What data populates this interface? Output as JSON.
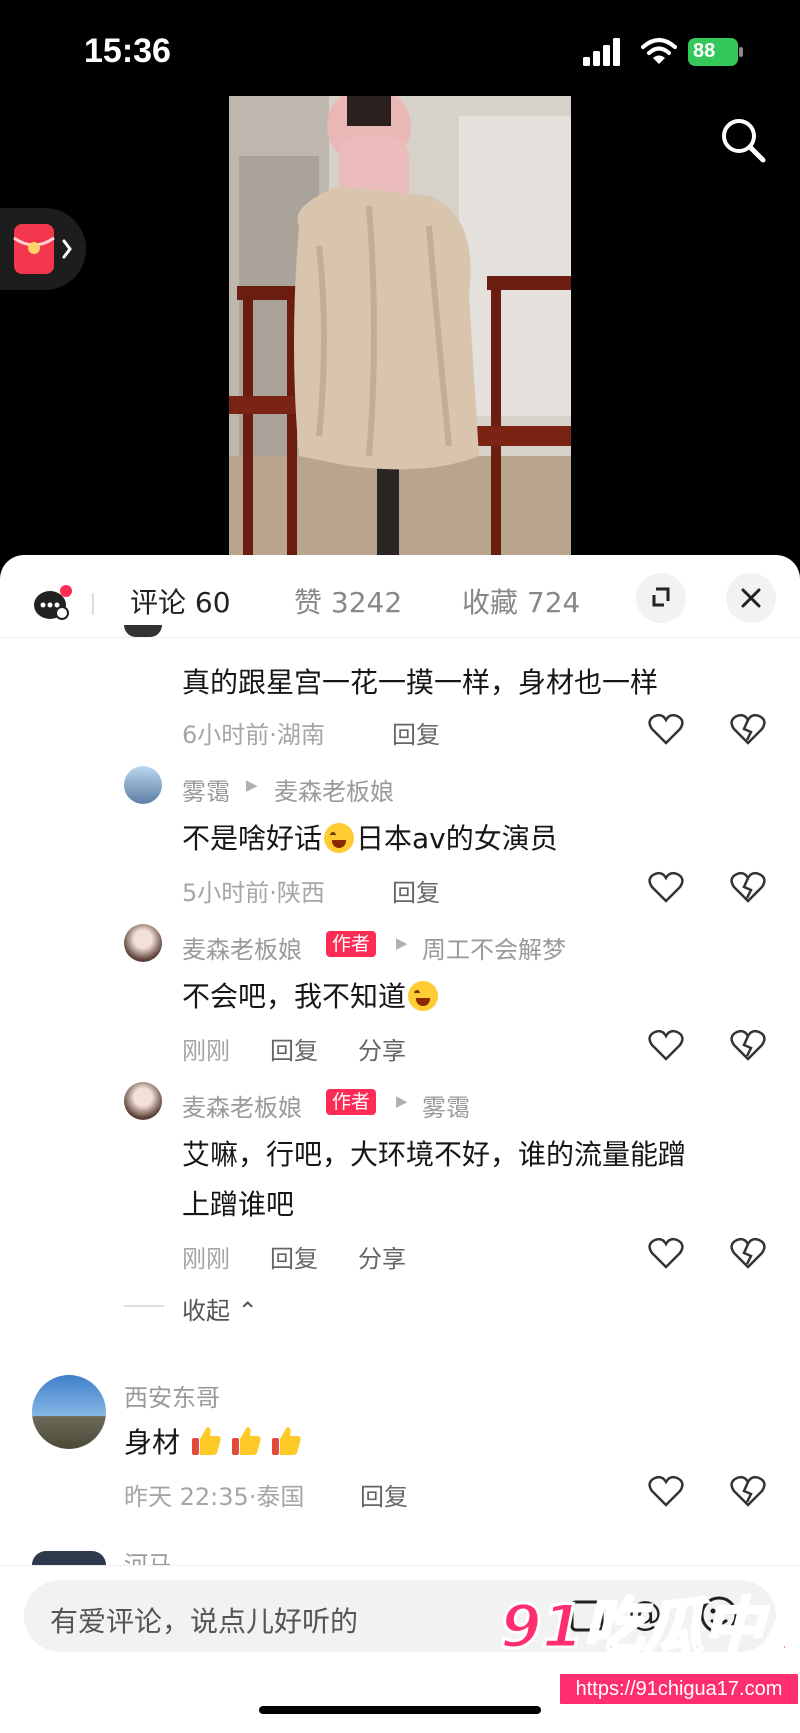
{
  "status": {
    "time": "15:36",
    "battery": "88"
  },
  "tabs": {
    "comments": "评论 60",
    "likes": "赞 3242",
    "favorites": "收藏 724"
  },
  "comments": [
    {
      "text": "真的跟星宫一花一摸一样，身材也一样",
      "time": "6小时前·湖南",
      "reply": "回复"
    },
    {
      "user": "雾霭",
      "reply_to": "麦森老板娘",
      "text": "不是啥好话",
      "text2": "日本av的女演员",
      "time": "5小时前·陕西",
      "reply": "回复"
    },
    {
      "user": "麦森老板娘",
      "tag": "作者",
      "reply_to": "周工不会解梦",
      "text": "不会吧，我不知道",
      "time": "刚刚",
      "reply": "回复",
      "share": "分享"
    },
    {
      "user": "麦森老板娘",
      "tag": "作者",
      "reply_to": "雾霭",
      "text_line1": "艾嘛，行吧，大环境不好，谁的流量能蹭",
      "text_line2": "上蹭谁吧",
      "time": "刚刚",
      "reply": "回复",
      "share": "分享"
    }
  ],
  "collapse": "收起",
  "top_comment": {
    "user": "西安东哥",
    "text": "身材",
    "time": "昨天 22:35·泰国",
    "reply": "回复"
  },
  "next_user_partial": "河马",
  "input": {
    "placeholder": "有爱评论，说点儿好听的"
  },
  "watermark": {
    "brand": "91吃瓜中心",
    "url": "https://91chigua17.com"
  },
  "colors": {
    "accent": "#fe2c55",
    "battery": "#34c759"
  }
}
